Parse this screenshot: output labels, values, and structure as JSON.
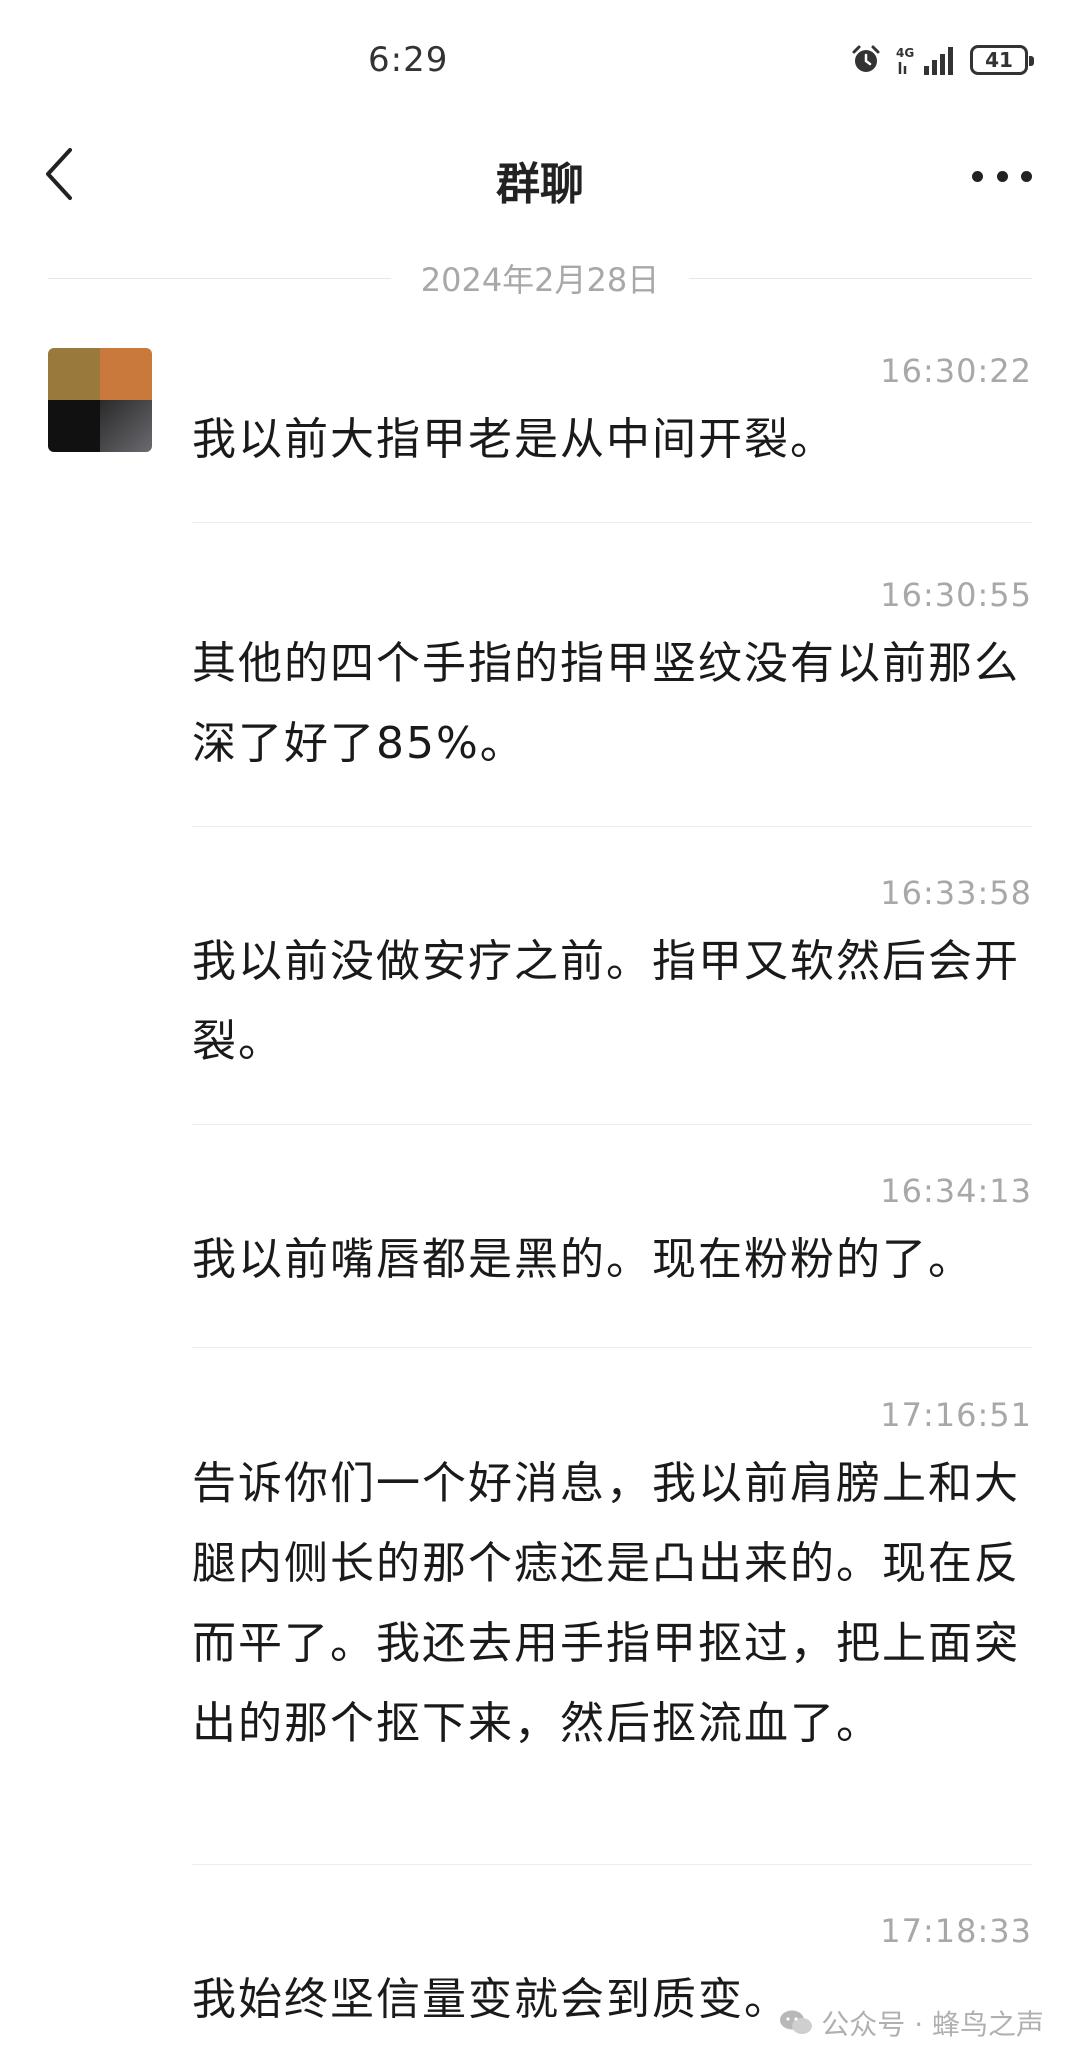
{
  "status_bar": {
    "time": "6:29",
    "network": "4G",
    "battery": "41"
  },
  "header": {
    "title": "群聊"
  },
  "date_divider": "2024年2月28日",
  "messages": [
    {
      "time": "16:30:22",
      "text": "我以前大指甲老是从中间开裂。"
    },
    {
      "time": "16:30:55",
      "text": "其他的四个手指的指甲竖纹没有以前那么深了好了85%。"
    },
    {
      "time": "16:33:58",
      "text": "我以前没做安疗之前。指甲又软然后会开裂。"
    },
    {
      "time": "16:34:13",
      "text": "我以前嘴唇都是黑的。现在粉粉的了。"
    },
    {
      "time": "17:16:51",
      "text": "告诉你们一个好消息，我以前肩膀上和大腿内侧长的那个痣还是凸出来的。现在反而平了。我还去用手指甲抠过，把上面突出的那个抠下来，然后抠流血了。"
    },
    {
      "time": "17:18:33",
      "text": "我始终坚信量变就会到质变。"
    }
  ],
  "watermark": "公众号 · 蜂鸟之声",
  "icons": {
    "back": "chevron-left-icon",
    "more": "more-horizontal-icon",
    "alarm": "alarm-icon",
    "signal": "signal-icon",
    "battery": "battery-icon",
    "wechat": "wechat-icon"
  }
}
